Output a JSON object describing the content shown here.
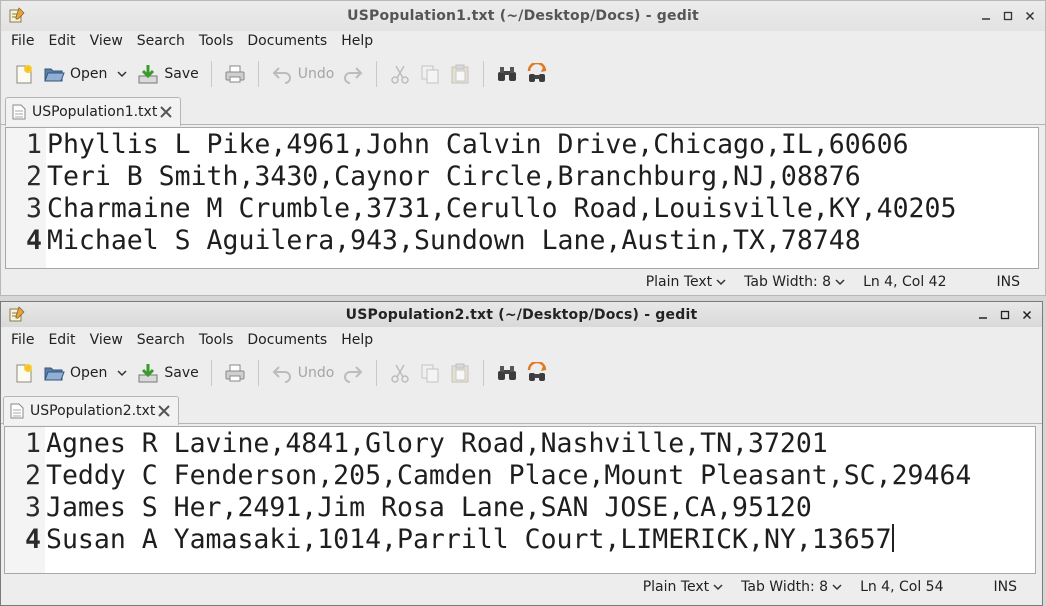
{
  "windows": [
    {
      "title": "USPopulation1.txt (~/Desktop/Docs) - gedit",
      "menu": [
        "File",
        "Edit",
        "View",
        "Search",
        "Tools",
        "Documents",
        "Help"
      ],
      "toolbar": {
        "open": "Open",
        "save": "Save",
        "undo": "Undo"
      },
      "tab": "USPopulation1.txt",
      "lines": [
        {
          "n": "1",
          "text": "Phyllis L Pike,4961,John Calvin Drive,Chicago,IL,60606"
        },
        {
          "n": "2",
          "text": "Teri B Smith,3430,Caynor Circle,Branchburg,NJ,08876"
        },
        {
          "n": "3",
          "text": "Charmaine M Crumble,3731,Cerullo Road,Louisville,KY,40205"
        },
        {
          "n": "4",
          "text": "Michael S Aguilera,943,Sundown Lane,Austin,TX,78748"
        }
      ],
      "status": {
        "language": "Plain Text",
        "tab_width": "Tab Width: 8",
        "position": "Ln 4, Col 42",
        "mode": "INS"
      }
    },
    {
      "title": "USPopulation2.txt (~/Desktop/Docs) - gedit",
      "menu": [
        "File",
        "Edit",
        "View",
        "Search",
        "Tools",
        "Documents",
        "Help"
      ],
      "toolbar": {
        "open": "Open",
        "save": "Save",
        "undo": "Undo"
      },
      "tab": "USPopulation2.txt",
      "lines": [
        {
          "n": "1",
          "text": "Agnes R Lavine,4841,Glory Road,Nashville,TN,37201"
        },
        {
          "n": "2",
          "text": "Teddy C Fenderson,205,Camden Place,Mount Pleasant,SC,29464"
        },
        {
          "n": "3",
          "text": "James S Her,2491,Jim Rosa Lane,SAN JOSE,CA,95120"
        },
        {
          "n": "4",
          "text": "Susan A Yamasaki,1014,Parrill Court,LIMERICK,NY,13657"
        }
      ],
      "status": {
        "language": "Plain Text",
        "tab_width": "Tab Width: 8",
        "position": "Ln 4, Col 54",
        "mode": "INS"
      }
    }
  ]
}
